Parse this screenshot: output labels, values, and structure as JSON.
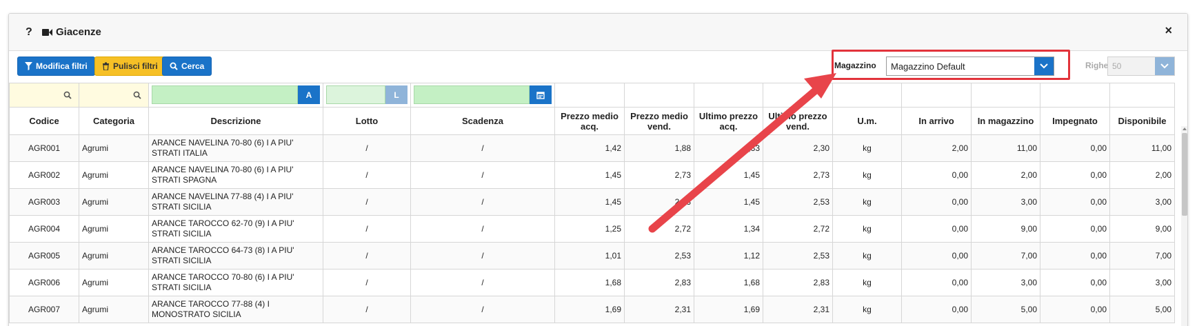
{
  "dialog": {
    "title": "Giacenze",
    "help_label": "?",
    "close_label": "×"
  },
  "toolbar": {
    "modifica_label": "Modifica filtri",
    "pulisci_label": "Pulisci filtri",
    "cerca_label": "Cerca",
    "magazzino_label": "Magazzino",
    "magazzino_value": "Magazzino Default",
    "righe_label": "Righe",
    "righe_value": "50"
  },
  "filters": {
    "descrizione_addon": "A",
    "lotto_addon": "L"
  },
  "table": {
    "columns": [
      "Codice",
      "Categoria",
      "Descrizione",
      "Lotto",
      "Scadenza",
      "Prezzo medio acq.",
      "Prezzo medio vend.",
      "Ultimo prezzo acq.",
      "Ultimo prezzo vend.",
      "U.m.",
      "In arrivo",
      "In magazzino",
      "Impegnato",
      "Disponibile"
    ],
    "rows": [
      [
        "AGR001",
        "Agrumi",
        "ARANCE NAVELINA 70-80 (6) I A PIU' STRATI ITALIA",
        "/",
        "/",
        "1,42",
        "1,88",
        "1,33",
        "2,30",
        "kg",
        "2,00",
        "11,00",
        "0,00",
        "11,00"
      ],
      [
        "AGR002",
        "Agrumi",
        "ARANCE NAVELINA 70-80 (6) I A PIU' STRATI SPAGNA",
        "/",
        "/",
        "1,45",
        "2,73",
        "1,45",
        "2,73",
        "kg",
        "0,00",
        "2,00",
        "0,00",
        "2,00"
      ],
      [
        "AGR003",
        "Agrumi",
        "ARANCE NAVELINA 77-88 (4) I A PIU' STRATI SICILIA",
        "/",
        "/",
        "1,45",
        "2,53",
        "1,45",
        "2,53",
        "kg",
        "0,00",
        "3,00",
        "0,00",
        "3,00"
      ],
      [
        "AGR004",
        "Agrumi",
        "ARANCE TAROCCO 62-70 (9) I A PIU' STRATI SICILIA",
        "/",
        "/",
        "1,25",
        "2,72",
        "1,34",
        "2,72",
        "kg",
        "0,00",
        "9,00",
        "0,00",
        "9,00"
      ],
      [
        "AGR005",
        "Agrumi",
        "ARANCE TAROCCO 64-73 (8) I A PIU' STRATI SICILIA",
        "/",
        "/",
        "1,01",
        "2,53",
        "1,12",
        "2,53",
        "kg",
        "0,00",
        "7,00",
        "0,00",
        "7,00"
      ],
      [
        "AGR006",
        "Agrumi",
        "ARANCE TAROCCO 70-80 (6) I A PIU' STRATI SICILIA",
        "/",
        "/",
        "1,68",
        "2,83",
        "1,68",
        "2,83",
        "kg",
        "0,00",
        "3,00",
        "0,00",
        "3,00"
      ],
      [
        "AGR007",
        "Agrumi",
        "ARANCE TAROCCO 77-88 (4) I MONOSTRATO SICILIA",
        "/",
        "/",
        "1,69",
        "2,31",
        "1,69",
        "2,31",
        "kg",
        "0,00",
        "5,00",
        "0,00",
        "5,00"
      ]
    ]
  },
  "colors": {
    "accent": "#1a73c8",
    "warning": "#f6c026",
    "annotation": "#e2333b",
    "filter_green": "#c4f0c4"
  },
  "icons": [
    "question-icon",
    "video-camera-icon",
    "close-icon",
    "filter-icon",
    "trash-icon",
    "search-icon",
    "chevron-down-icon",
    "calendar-icon"
  ]
}
